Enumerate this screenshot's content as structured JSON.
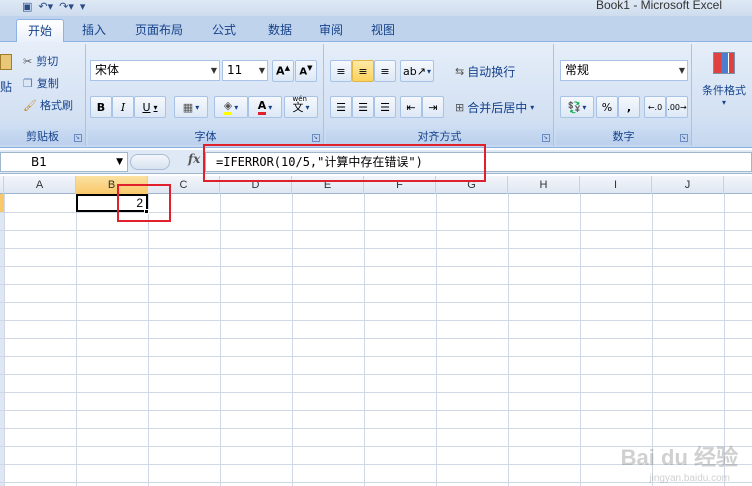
{
  "window": {
    "title": "Book1 - Microsoft Excel"
  },
  "tabs": [
    "开始",
    "插入",
    "页面布局",
    "公式",
    "数据",
    "审阅",
    "视图"
  ],
  "active_tab": "开始",
  "clipboard": {
    "paste_label": "贴",
    "cut_label": "剪切",
    "copy_label": "复制",
    "format_painter_label": "格式刷",
    "group_label": "剪贴板"
  },
  "font": {
    "name": "宋体",
    "size": "11",
    "bold": "B",
    "italic": "I",
    "underline": "U",
    "font_color_glyph": "A",
    "phonetic_glyph": "文",
    "phonetic_top": "wén",
    "group_label": "字体"
  },
  "alignment": {
    "wrap_text_label": "自动换行",
    "merge_center_label": "合并后居中",
    "group_label": "对齐方式"
  },
  "number": {
    "format": "常规",
    "percent": "%",
    "comma": ",",
    "group_label": "数字"
  },
  "styles": {
    "conditional_format_label": "条件格式"
  },
  "formula_bar": {
    "name_box": "B1",
    "fx": "fx",
    "formula": "=IFERROR(10/5,\"计算中存在错误\")"
  },
  "columns": [
    "A",
    "B",
    "C",
    "D",
    "E",
    "F",
    "G",
    "H",
    "I",
    "J"
  ],
  "selected_column": "B",
  "cells": {
    "B1": "2"
  },
  "watermark": {
    "text": "Bai du 经验",
    "sub": "jingyan.baidu.com"
  },
  "colors": {
    "accent": "#15428b",
    "annotation": "#e0202a",
    "selected_header": "#f9c86a"
  }
}
